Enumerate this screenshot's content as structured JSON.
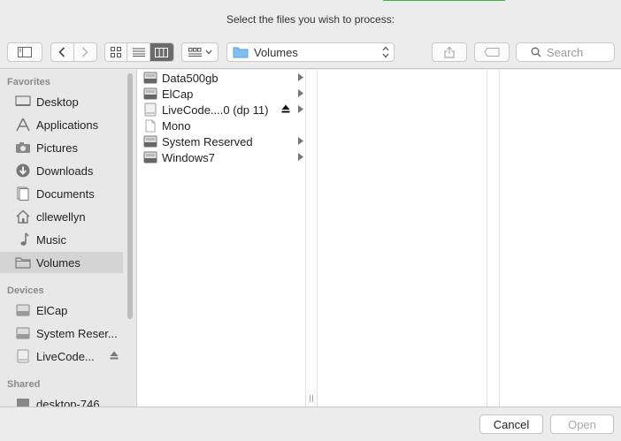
{
  "dialog": {
    "title": "Select the files you wish to process:"
  },
  "toolbar": {
    "path_location": "Volumes",
    "search_placeholder": "Search",
    "view_modes": [
      "icon",
      "list",
      "column"
    ],
    "active_view": "column"
  },
  "sidebar": {
    "favorites_header": "Favorites",
    "favorites": [
      {
        "label": "Desktop",
        "icon": "desktop-icon"
      },
      {
        "label": "Applications",
        "icon": "applications-icon"
      },
      {
        "label": "Pictures",
        "icon": "camera-icon"
      },
      {
        "label": "Downloads",
        "icon": "download-icon"
      },
      {
        "label": "Documents",
        "icon": "document-icon"
      },
      {
        "label": "cllewellyn",
        "icon": "home-icon"
      },
      {
        "label": "Music",
        "icon": "music-note-icon"
      },
      {
        "label": "Volumes",
        "icon": "folder-icon",
        "selected": true
      }
    ],
    "devices_header": "Devices",
    "devices": [
      {
        "label": "ElCap",
        "icon": "drive-icon"
      },
      {
        "label": "System Reser...",
        "icon": "drive-icon"
      },
      {
        "label": "LiveCode...",
        "icon": "disk-image-icon",
        "ejectable": true
      }
    ],
    "shared_header": "Shared",
    "shared": [
      {
        "label": "desktop-746",
        "icon": "computer-icon"
      }
    ]
  },
  "browser": {
    "column1": [
      {
        "label": "Data500gb",
        "icon": "drive-icon",
        "has_children": true
      },
      {
        "label": "ElCap",
        "icon": "drive-icon",
        "has_children": true
      },
      {
        "label": "LiveCode....0 (dp 11)",
        "icon": "disk-image-icon",
        "has_children": true,
        "ejectable": true
      },
      {
        "label": "Mono",
        "icon": "file-icon",
        "has_children": false
      },
      {
        "label": "System Reserved",
        "icon": "drive-icon",
        "has_children": true
      },
      {
        "label": "Windows7",
        "icon": "drive-icon",
        "has_children": true
      }
    ]
  },
  "footer": {
    "cancel_label": "Cancel",
    "open_label": "Open",
    "open_enabled": false
  },
  "colors": {
    "selection": "#d4d4d4",
    "active_segment": "#6b6b6b",
    "title_accent": "#3cb44a"
  }
}
